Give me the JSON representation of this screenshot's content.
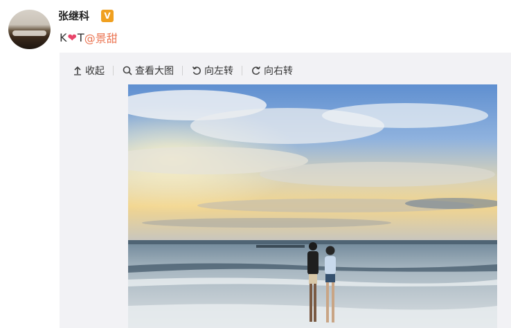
{
  "post": {
    "author": "张继科",
    "verified_badge": "V",
    "text_prefix": "K",
    "text_heart": "❤",
    "text_suffix": "T",
    "mention": "@景甜"
  },
  "toolbar": {
    "collapse": "收起",
    "view_large": "查看大图",
    "rotate_left": "向左转",
    "rotate_right": "向右转"
  },
  "colors": {
    "mention": "#eb7350",
    "heart": "#e8456a",
    "badge": "#f0a020"
  }
}
